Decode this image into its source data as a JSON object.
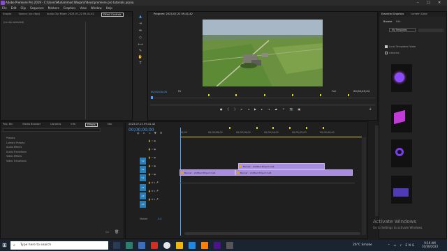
{
  "window": {
    "title": "Adobe Premiere Pro 2019 - C:\\Users\\Muhammad Waqar\\Videos\\premiere pro tutorials.prproj"
  },
  "menu": [
    "File",
    "Edit",
    "Clip",
    "Sequence",
    "Markers",
    "Graphics",
    "View",
    "Window",
    "Help"
  ],
  "source_panel": {
    "tabs": [
      "Scopes",
      "Source: (no clips)",
      "Audio Clip Mixer: 2023-07-22 09-41-42",
      "Effect Controls"
    ],
    "no_clip": "(no clip selected)"
  },
  "program": {
    "title": "Program: 2023-07-22 09-41-42",
    "timecode": "00;00;00;00",
    "fit": "Fit",
    "full": "Full",
    "duration": "00;00;45;04"
  },
  "essential": {
    "tabs": [
      "Essential Graphics",
      "Lumetri Color"
    ],
    "subtabs": [
      "Browse",
      "Edit"
    ],
    "dropdown": "My Templates",
    "checkbox": "Local Templates Folder",
    "libraries": "Libraries"
  },
  "project": {
    "tabs": [
      "Proj: Bin",
      "Media Browser",
      "Libraries",
      "Info",
      "Effects",
      "Mar"
    ],
    "items": [
      "Presets",
      "Lumetri Presets",
      "Audio Effects",
      "Audio Transitions",
      "Video Effects",
      "Video Transitions"
    ]
  },
  "timeline": {
    "title": "2023-07-22 09-41-42",
    "timecode": "00;00;00;00",
    "ruler": [
      "00;00",
      "00;00;08;00",
      "00;00;16;00",
      "00;00;24;00",
      "00;00;32;00",
      "00;00;40;00"
    ],
    "video_tracks": [
      "V3",
      "V2",
      "V1"
    ],
    "audio_tracks": [
      "A1",
      "A2",
      "A3"
    ],
    "master": "Master",
    "master_val": "0.0",
    "clip1": "Banner - Untitled Project.mp4",
    "clip2": "Banner - Untitled Project.mp4",
    "clip3": "Banner - Untitled Project.mp4"
  },
  "watermark": {
    "line1": "Activate Windows",
    "line2": "Go to Settings to activate Windows."
  },
  "taskbar": {
    "search": "Type here to search",
    "weather": "26°C  Smoke",
    "time": "9:19 AM",
    "date": "10/30/2023"
  }
}
